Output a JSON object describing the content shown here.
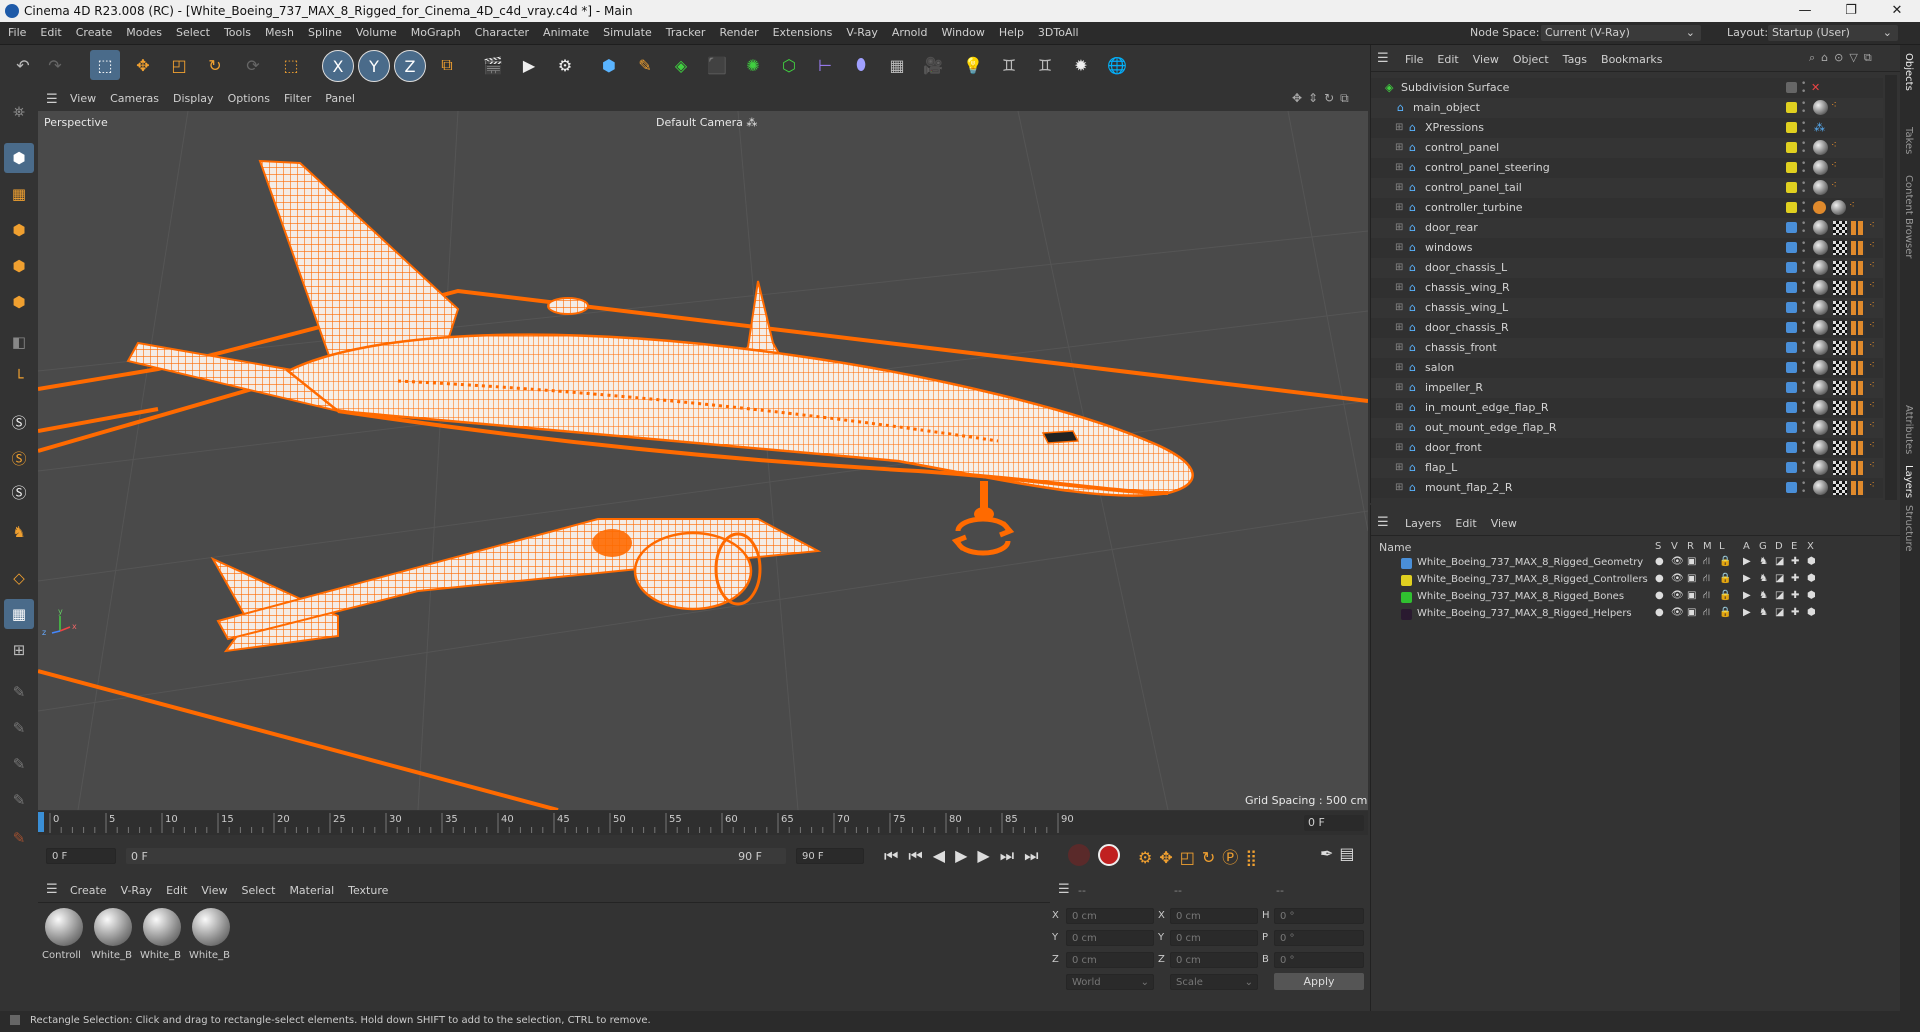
{
  "window": {
    "title": "Cinema 4D R23.008 (RC) - [White_Boeing_737_MAX_8_Rigged_for_Cinema_4D_c4d_vray.c4d *] - Main",
    "controls": [
      "—",
      "❐",
      "✕"
    ]
  },
  "menu": [
    "File",
    "Edit",
    "Create",
    "Modes",
    "Select",
    "Tools",
    "Mesh",
    "Spline",
    "Volume",
    "MoGraph",
    "Character",
    "Animate",
    "Simulate",
    "Tracker",
    "Render",
    "Extensions",
    "V-Ray",
    "Arnold",
    "Window",
    "Help",
    "3DToAll"
  ],
  "node_space": {
    "label": "Node Space:",
    "value": "Current (V-Ray)"
  },
  "layout": {
    "label": "Layout:",
    "value": "Startup (User)"
  },
  "viewport": {
    "menu": [
      "View",
      "Cameras",
      "Display",
      "Options",
      "Filter",
      "Panel"
    ],
    "label": "Perspective",
    "camera": "Default Camera",
    "grid_spacing": "Grid Spacing : 500 cm",
    "accent": "#ff6a00"
  },
  "timeline": {
    "ticks": [
      "0",
      "5",
      "10",
      "15",
      "20",
      "25",
      "30",
      "35",
      "40",
      "45",
      "50",
      "55",
      "60",
      "65",
      "70",
      "75",
      "80",
      "85",
      "90"
    ],
    "current_frame": "0 F",
    "start": "0 F",
    "range_start": "0 F",
    "range_end": "90 F",
    "end": "90 F"
  },
  "materials": {
    "menu": [
      "Create",
      "V-Ray",
      "Edit",
      "View",
      "Select",
      "Material",
      "Texture"
    ],
    "items": [
      "Controll",
      "White_B",
      "White_B",
      "White_B"
    ]
  },
  "coords": {
    "header": [
      "--",
      "--",
      "--"
    ],
    "rows": [
      {
        "a": "X",
        "av": "0 cm",
        "b": "X",
        "bv": "0 cm",
        "c": "H",
        "cv": "0 °"
      },
      {
        "a": "Y",
        "av": "0 cm",
        "b": "Y",
        "bv": "0 cm",
        "c": "P",
        "cv": "0 °"
      },
      {
        "a": "Z",
        "av": "0 cm",
        "b": "Z",
        "bv": "0 cm",
        "c": "B",
        "cv": "0 °"
      }
    ],
    "world": "World",
    "scale": "Scale",
    "apply": "Apply"
  },
  "status": "Rectangle Selection: Click and drag to rectangle-select elements. Hold down SHIFT to add to the selection, CTRL to remove.",
  "objects": {
    "menu": [
      "File",
      "Edit",
      "View",
      "Object",
      "Tags",
      "Bookmarks"
    ],
    "items": [
      {
        "name": "Subdivision Surface",
        "indent": 0,
        "color": "#888888"
      },
      {
        "name": "main_object",
        "indent": 1,
        "color": "#e0d020"
      },
      {
        "name": "XPressions",
        "indent": 2,
        "color": "#e0d020"
      },
      {
        "name": "control_panel",
        "indent": 2,
        "color": "#e0d020"
      },
      {
        "name": "control_panel_steering",
        "indent": 2,
        "color": "#e0d020"
      },
      {
        "name": "control_panel_tail",
        "indent": 2,
        "color": "#e0d020"
      },
      {
        "name": "controller_turbine",
        "indent": 2,
        "color": "#e0d020"
      },
      {
        "name": "door_rear",
        "indent": 2,
        "color": "#4a8fd8"
      },
      {
        "name": "windows",
        "indent": 2,
        "color": "#4a8fd8"
      },
      {
        "name": "door_chassis_L",
        "indent": 2,
        "color": "#4a8fd8"
      },
      {
        "name": "chassis_wing_R",
        "indent": 2,
        "color": "#4a8fd8"
      },
      {
        "name": "chassis_wing_L",
        "indent": 2,
        "color": "#4a8fd8"
      },
      {
        "name": "door_chassis_R",
        "indent": 2,
        "color": "#4a8fd8"
      },
      {
        "name": "chassis_front",
        "indent": 2,
        "color": "#4a8fd8"
      },
      {
        "name": "salon",
        "indent": 2,
        "color": "#4a8fd8"
      },
      {
        "name": "impeller_R",
        "indent": 2,
        "color": "#4a8fd8"
      },
      {
        "name": "in_mount_edge_flap_R",
        "indent": 2,
        "color": "#4a8fd8"
      },
      {
        "name": "out_mount_edge_flap_R",
        "indent": 2,
        "color": "#4a8fd8"
      },
      {
        "name": "door_front",
        "indent": 2,
        "color": "#4a8fd8"
      },
      {
        "name": "flap_L",
        "indent": 2,
        "color": "#4a8fd8"
      },
      {
        "name": "mount_flap_2_R",
        "indent": 2,
        "color": "#4a8fd8"
      }
    ]
  },
  "layers": {
    "menu": [
      "Layers",
      "Edit",
      "View"
    ],
    "header_name": "Name",
    "header_cols": [
      "S",
      "V",
      "R",
      "M",
      "L",
      "A",
      "G",
      "D",
      "E",
      "X"
    ],
    "items": [
      {
        "name": "White_Boeing_737_MAX_8_Rigged_Geometry",
        "color": "#4a8fd8"
      },
      {
        "name": "White_Boeing_737_MAX_8_Rigged_Controllers",
        "color": "#e0d020"
      },
      {
        "name": "White_Boeing_737_MAX_8_Rigged_Bones",
        "color": "#30c030"
      },
      {
        "name": "White_Boeing_737_MAX_8_Rigged_Helpers",
        "color": "#2a1a30"
      }
    ]
  },
  "side_tabs": [
    "Objects",
    "Takes",
    "Content Browser",
    "Attributes",
    "Layers",
    "Structure"
  ]
}
